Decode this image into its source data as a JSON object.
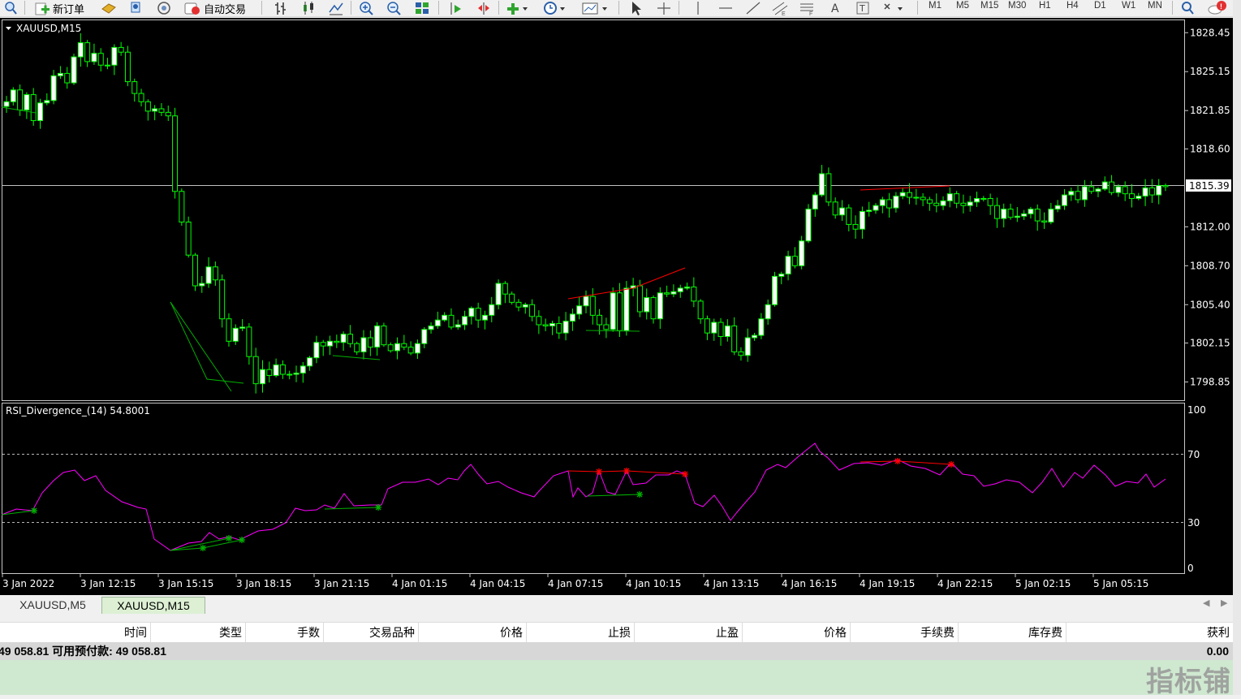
{
  "toolbar": {
    "new_order_label": "新订单",
    "auto_trading_label": "自动交易",
    "timeframes": [
      "M1",
      "M5",
      "M15",
      "M30",
      "H1",
      "H4",
      "D1",
      "W1",
      "MN"
    ]
  },
  "chart": {
    "title": "XAUUSD,M15",
    "current_price_label": "1815.39",
    "price_axis_labels": [
      "1828.45",
      "1825.15",
      "1821.85",
      "1818.60",
      "1815.39",
      "1812.00",
      "1808.70",
      "1805.40",
      "1802.15",
      "1798.85"
    ],
    "indicator_title": "RSI_Divergence_(14) 54.8001",
    "rsi_axis_labels": [
      "100",
      "70",
      "30",
      "0"
    ],
    "time_axis_labels": [
      "3 Jan 2022",
      "3 Jan 12:15",
      "3 Jan 15:15",
      "3 Jan 18:15",
      "3 Jan 21:15",
      "4 Jan 01:15",
      "4 Jan 04:15",
      "4 Jan 07:15",
      "4 Jan 10:15",
      "4 Jan 13:15",
      "4 Jan 16:15",
      "4 Jan 19:15",
      "4 Jan 22:15",
      "5 Jan 02:15",
      "5 Jan 05:15"
    ],
    "colors": {
      "background": "#000000",
      "bull_candle": "#ffffff",
      "bear_candle": "#000000",
      "candle_wick": "#00ff00",
      "rsi_line": "#ff00ff",
      "bearish_divergence": "#ff0000",
      "bullish_divergence": "#00b000"
    }
  },
  "chart_data": {
    "type": "candlestick",
    "symbol": "XAUUSD",
    "timeframe": "M15",
    "ylim": [
      1797.3,
      1829.5
    ],
    "closes": [
      1822.6,
      1823.6,
      1821.9,
      1823.2,
      1821.0,
      1822.5,
      1822.7,
      1824.8,
      1825.0,
      1824.2,
      1826.4,
      1827.6,
      1826.0,
      1826.7,
      1825.7,
      1825.7,
      1827.2,
      1826.8,
      1824.3,
      1823.3,
      1822.6,
      1821.8,
      1822.0,
      1821.7,
      1821.4,
      1815.0,
      1812.4,
      1809.6,
      1807.0,
      1807.2,
      1808.6,
      1807.5,
      1804.2,
      1802.3,
      1803.4,
      1803.5,
      1801.0,
      1798.7,
      1799.9,
      1799.4,
      1800.3,
      1799.5,
      1799.5,
      1799.6,
      1800.2,
      1800.9,
      1802.2,
      1801.9,
      1802.3,
      1802.2,
      1802.9,
      1802.1,
      1801.4,
      1802.6,
      1801.8,
      1803.6,
      1802.0,
      1801.5,
      1802.1,
      1801.8,
      1801.3,
      1802.1,
      1803.3,
      1803.6,
      1804.1,
      1804.5,
      1803.5,
      1803.7,
      1804.4,
      1805.1,
      1804.1,
      1804.5,
      1805.4,
      1807.2,
      1806.3,
      1805.6,
      1805.2,
      1805.4,
      1804.4,
      1803.7,
      1803.6,
      1803.8,
      1803.0,
      1804.0,
      1804.6,
      1805.3,
      1806.1,
      1804.5,
      1803.7,
      1803.3,
      1806.4,
      1803.2,
      1806.8,
      1807.0,
      1804.8,
      1806.0,
      1804.2,
      1806.4,
      1806.3,
      1806.5,
      1806.8,
      1806.9,
      1805.7,
      1804.2,
      1803.0,
      1803.9,
      1802.7,
      1803.6,
      1801.4,
      1801.1,
      1802.6,
      1802.8,
      1804.2,
      1805.4,
      1807.8,
      1808.0,
      1809.5,
      1808.7,
      1810.8,
      1813.5,
      1814.7,
      1816.5,
      1814.1,
      1813.0,
      1813.6,
      1812.2,
      1811.8,
      1813.3,
      1813.4,
      1813.8,
      1814.3,
      1813.6,
      1814.6,
      1814.9,
      1814.5,
      1814.5,
      1814.3,
      1814.0,
      1813.8,
      1814.2,
      1814.8,
      1814.0,
      1813.8,
      1814.1,
      1814.4,
      1814.4,
      1813.8,
      1812.7,
      1813.5,
      1812.8,
      1812.9,
      1813.1,
      1813.5,
      1812.5,
      1812.4,
      1813.5,
      1813.8,
      1814.7,
      1815.0,
      1814.3,
      1815.4,
      1815.0,
      1815.2,
      1815.8,
      1814.9,
      1815.4,
      1814.8,
      1814.4,
      1814.6,
      1815.3,
      1814.7,
      1815.5,
      1815.4
    ]
  },
  "tabs": [
    "XAUUSD,M5",
    "XAUUSD,M15"
  ],
  "terminal": {
    "columns": [
      "时间",
      "类型",
      "手数",
      "交易品种",
      "价格",
      "止损",
      "止盈",
      "价格",
      "手续费",
      "库存费",
      "获利"
    ],
    "balance_text": "49 058.81  可用预付款: 49 058.81",
    "profit_total": "0.00"
  },
  "watermark": "指标铺"
}
